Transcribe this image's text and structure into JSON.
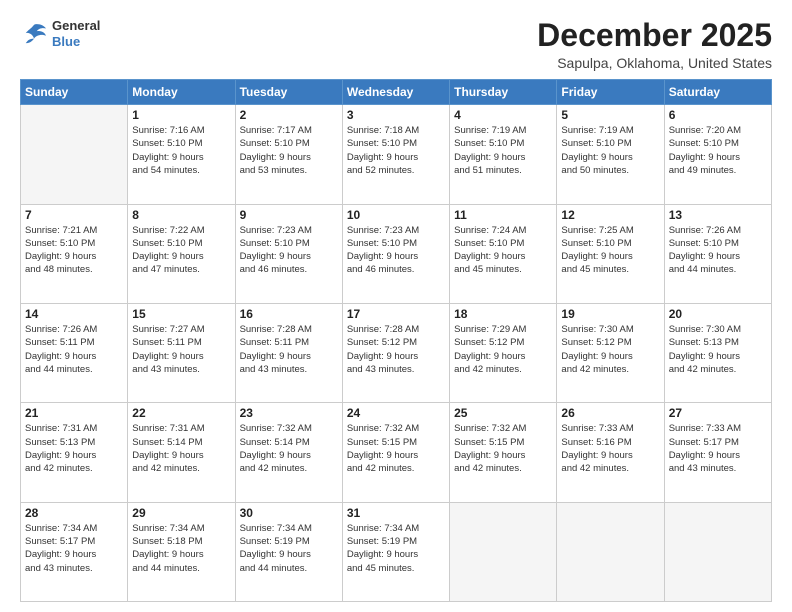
{
  "header": {
    "logo": {
      "general": "General",
      "blue": "Blue"
    },
    "title": "December 2025",
    "location": "Sapulpa, Oklahoma, United States"
  },
  "days_of_week": [
    "Sunday",
    "Monday",
    "Tuesday",
    "Wednesday",
    "Thursday",
    "Friday",
    "Saturday"
  ],
  "weeks": [
    [
      {
        "day": "",
        "info": ""
      },
      {
        "day": "1",
        "info": "Sunrise: 7:16 AM\nSunset: 5:10 PM\nDaylight: 9 hours\nand 54 minutes."
      },
      {
        "day": "2",
        "info": "Sunrise: 7:17 AM\nSunset: 5:10 PM\nDaylight: 9 hours\nand 53 minutes."
      },
      {
        "day": "3",
        "info": "Sunrise: 7:18 AM\nSunset: 5:10 PM\nDaylight: 9 hours\nand 52 minutes."
      },
      {
        "day": "4",
        "info": "Sunrise: 7:19 AM\nSunset: 5:10 PM\nDaylight: 9 hours\nand 51 minutes."
      },
      {
        "day": "5",
        "info": "Sunrise: 7:19 AM\nSunset: 5:10 PM\nDaylight: 9 hours\nand 50 minutes."
      },
      {
        "day": "6",
        "info": "Sunrise: 7:20 AM\nSunset: 5:10 PM\nDaylight: 9 hours\nand 49 minutes."
      }
    ],
    [
      {
        "day": "7",
        "info": "Sunrise: 7:21 AM\nSunset: 5:10 PM\nDaylight: 9 hours\nand 48 minutes."
      },
      {
        "day": "8",
        "info": "Sunrise: 7:22 AM\nSunset: 5:10 PM\nDaylight: 9 hours\nand 47 minutes."
      },
      {
        "day": "9",
        "info": "Sunrise: 7:23 AM\nSunset: 5:10 PM\nDaylight: 9 hours\nand 46 minutes."
      },
      {
        "day": "10",
        "info": "Sunrise: 7:23 AM\nSunset: 5:10 PM\nDaylight: 9 hours\nand 46 minutes."
      },
      {
        "day": "11",
        "info": "Sunrise: 7:24 AM\nSunset: 5:10 PM\nDaylight: 9 hours\nand 45 minutes."
      },
      {
        "day": "12",
        "info": "Sunrise: 7:25 AM\nSunset: 5:10 PM\nDaylight: 9 hours\nand 45 minutes."
      },
      {
        "day": "13",
        "info": "Sunrise: 7:26 AM\nSunset: 5:10 PM\nDaylight: 9 hours\nand 44 minutes."
      }
    ],
    [
      {
        "day": "14",
        "info": "Sunrise: 7:26 AM\nSunset: 5:11 PM\nDaylight: 9 hours\nand 44 minutes."
      },
      {
        "day": "15",
        "info": "Sunrise: 7:27 AM\nSunset: 5:11 PM\nDaylight: 9 hours\nand 43 minutes."
      },
      {
        "day": "16",
        "info": "Sunrise: 7:28 AM\nSunset: 5:11 PM\nDaylight: 9 hours\nand 43 minutes."
      },
      {
        "day": "17",
        "info": "Sunrise: 7:28 AM\nSunset: 5:12 PM\nDaylight: 9 hours\nand 43 minutes."
      },
      {
        "day": "18",
        "info": "Sunrise: 7:29 AM\nSunset: 5:12 PM\nDaylight: 9 hours\nand 42 minutes."
      },
      {
        "day": "19",
        "info": "Sunrise: 7:30 AM\nSunset: 5:12 PM\nDaylight: 9 hours\nand 42 minutes."
      },
      {
        "day": "20",
        "info": "Sunrise: 7:30 AM\nSunset: 5:13 PM\nDaylight: 9 hours\nand 42 minutes."
      }
    ],
    [
      {
        "day": "21",
        "info": "Sunrise: 7:31 AM\nSunset: 5:13 PM\nDaylight: 9 hours\nand 42 minutes."
      },
      {
        "day": "22",
        "info": "Sunrise: 7:31 AM\nSunset: 5:14 PM\nDaylight: 9 hours\nand 42 minutes."
      },
      {
        "day": "23",
        "info": "Sunrise: 7:32 AM\nSunset: 5:14 PM\nDaylight: 9 hours\nand 42 minutes."
      },
      {
        "day": "24",
        "info": "Sunrise: 7:32 AM\nSunset: 5:15 PM\nDaylight: 9 hours\nand 42 minutes."
      },
      {
        "day": "25",
        "info": "Sunrise: 7:32 AM\nSunset: 5:15 PM\nDaylight: 9 hours\nand 42 minutes."
      },
      {
        "day": "26",
        "info": "Sunrise: 7:33 AM\nSunset: 5:16 PM\nDaylight: 9 hours\nand 42 minutes."
      },
      {
        "day": "27",
        "info": "Sunrise: 7:33 AM\nSunset: 5:17 PM\nDaylight: 9 hours\nand 43 minutes."
      }
    ],
    [
      {
        "day": "28",
        "info": "Sunrise: 7:34 AM\nSunset: 5:17 PM\nDaylight: 9 hours\nand 43 minutes."
      },
      {
        "day": "29",
        "info": "Sunrise: 7:34 AM\nSunset: 5:18 PM\nDaylight: 9 hours\nand 44 minutes."
      },
      {
        "day": "30",
        "info": "Sunrise: 7:34 AM\nSunset: 5:19 PM\nDaylight: 9 hours\nand 44 minutes."
      },
      {
        "day": "31",
        "info": "Sunrise: 7:34 AM\nSunset: 5:19 PM\nDaylight: 9 hours\nand 45 minutes."
      },
      {
        "day": "",
        "info": ""
      },
      {
        "day": "",
        "info": ""
      },
      {
        "day": "",
        "info": ""
      }
    ]
  ]
}
